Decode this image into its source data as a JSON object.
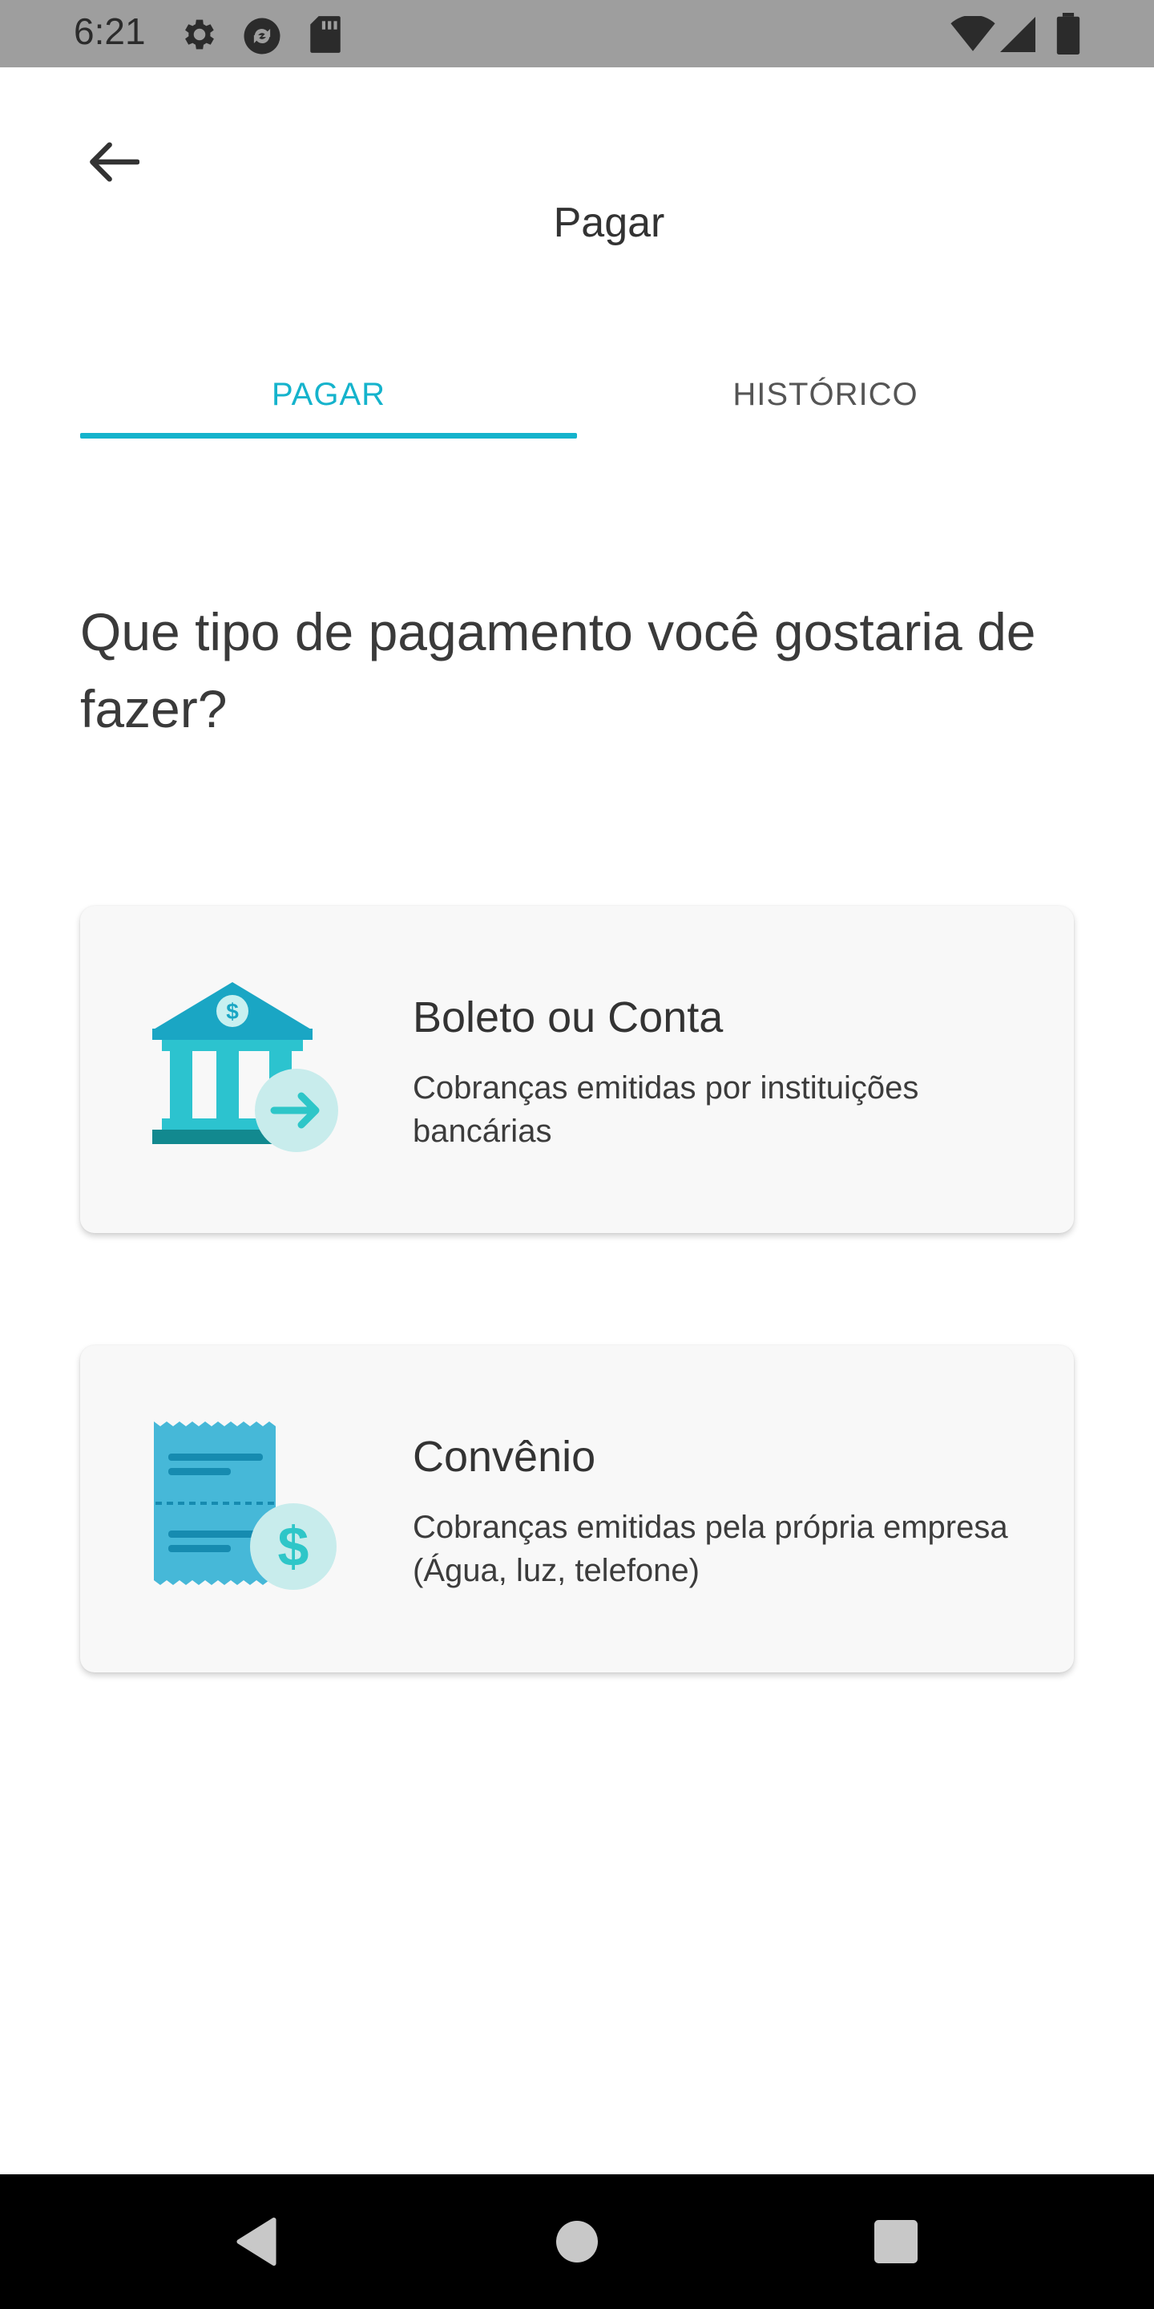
{
  "status_bar": {
    "time": "6:21",
    "icons_left": [
      "settings-icon",
      "sync-icon",
      "sd-card-icon"
    ],
    "icons_right": [
      "wifi-icon",
      "signal-icon",
      "battery-icon"
    ]
  },
  "header": {
    "title": "Pagar",
    "back_icon": "arrow-back-icon"
  },
  "tabs": [
    {
      "label": "PAGAR",
      "selected": true
    },
    {
      "label": "HISTÓRICO",
      "selected": false
    }
  ],
  "main": {
    "question": "Que tipo de pagamento você gostaria de fazer?",
    "options": [
      {
        "title": "Boleto ou Conta",
        "description": "Cobranças emitidas por instituições bancárias",
        "icon": "bank-transfer-icon"
      },
      {
        "title": "Convênio",
        "description": "Cobranças emitidas pela própria empresa (Água, luz, telefone)",
        "icon": "receipt-dollar-icon"
      }
    ]
  },
  "nav_bar": {
    "buttons": [
      "back-triangle-icon",
      "home-circle-icon",
      "recents-square-icon"
    ]
  },
  "colors": {
    "accent": "#15b3cc",
    "status_bar": "#9e9e9e",
    "card_bg": "#f8f8f8",
    "nav_bar": "#000000"
  }
}
